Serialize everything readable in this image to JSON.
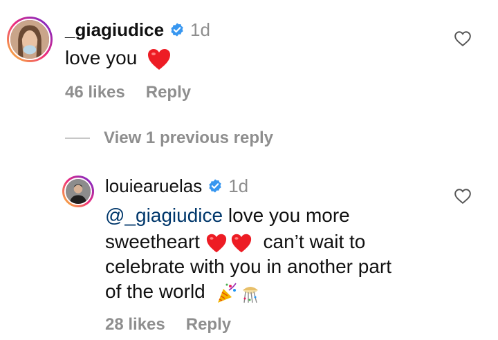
{
  "comments": [
    {
      "username": "_giagiudice",
      "time": "1d",
      "text": "love you",
      "likes": "46 likes",
      "reply": "Reply"
    },
    {
      "username": "louiearuelas",
      "time": "1d",
      "mention": "@_giagiudice",
      "text_line1": " love you more",
      "text_line2": "sweetheart",
      "text_line2b": "can’t wait to",
      "text_line3": "celebrate with you in another part",
      "text_line4": "of the world",
      "likes": "28 likes",
      "reply": "Reply"
    }
  ],
  "view_replies": "View 1 previous reply",
  "colors": {
    "verified": "#3897f0",
    "heart": "#ed1c24",
    "muted": "#8e8e8e",
    "mention": "#00376b"
  },
  "icons": [
    "verified-badge-icon",
    "red-heart-emoji",
    "like-heart-icon",
    "party-popper-emoji",
    "confetti-ball-emoji"
  ]
}
